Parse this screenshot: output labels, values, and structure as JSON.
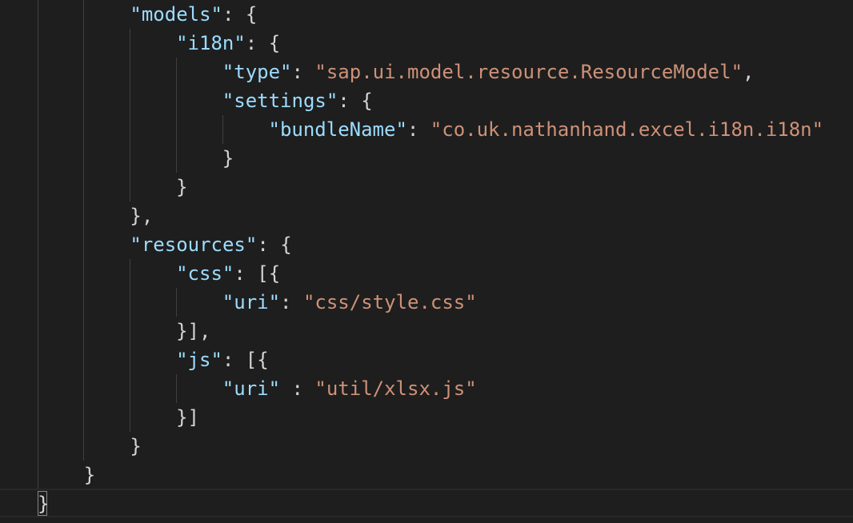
{
  "editor": {
    "theme_colors": {
      "background": "#1e1e1e",
      "property_key": "#9cdcfe",
      "string_value": "#ce9178",
      "punctuation": "#d4d4d4",
      "indent_guide": "#404040"
    },
    "lines": [
      {
        "indent": 2,
        "parts": [
          {
            "t": "key",
            "v": "\"models\""
          },
          {
            "t": "pun",
            "v": ": {"
          }
        ]
      },
      {
        "indent": 3,
        "parts": [
          {
            "t": "key",
            "v": "\"i18n\""
          },
          {
            "t": "pun",
            "v": ": {"
          }
        ]
      },
      {
        "indent": 4,
        "parts": [
          {
            "t": "key",
            "v": "\"type\""
          },
          {
            "t": "pun",
            "v": ": "
          },
          {
            "t": "str",
            "v": "\"sap.ui.model.resource.ResourceModel\""
          },
          {
            "t": "pun",
            "v": ","
          }
        ]
      },
      {
        "indent": 4,
        "parts": [
          {
            "t": "key",
            "v": "\"settings\""
          },
          {
            "t": "pun",
            "v": ": {"
          }
        ]
      },
      {
        "indent": 5,
        "parts": [
          {
            "t": "key",
            "v": "\"bundleName\""
          },
          {
            "t": "pun",
            "v": ": "
          },
          {
            "t": "str",
            "v": "\"co.uk.nathanhand.excel.i18n.i18n\""
          }
        ]
      },
      {
        "indent": 4,
        "parts": [
          {
            "t": "pun",
            "v": "}"
          }
        ]
      },
      {
        "indent": 3,
        "parts": [
          {
            "t": "pun",
            "v": "}"
          }
        ]
      },
      {
        "indent": 2,
        "parts": [
          {
            "t": "pun",
            "v": "},"
          }
        ]
      },
      {
        "indent": 2,
        "parts": [
          {
            "t": "key",
            "v": "\"resources\""
          },
          {
            "t": "pun",
            "v": ": {"
          }
        ]
      },
      {
        "indent": 3,
        "parts": [
          {
            "t": "key",
            "v": "\"css\""
          },
          {
            "t": "pun",
            "v": ": [{"
          }
        ]
      },
      {
        "indent": 4,
        "parts": [
          {
            "t": "key",
            "v": "\"uri\""
          },
          {
            "t": "pun",
            "v": ": "
          },
          {
            "t": "str",
            "v": "\"css/style.css\""
          }
        ]
      },
      {
        "indent": 3,
        "parts": [
          {
            "t": "pun",
            "v": "}],"
          }
        ]
      },
      {
        "indent": 3,
        "parts": [
          {
            "t": "key",
            "v": "\"js\""
          },
          {
            "t": "pun",
            "v": ": [{"
          }
        ]
      },
      {
        "indent": 4,
        "parts": [
          {
            "t": "key",
            "v": "\"uri\""
          },
          {
            "t": "pun",
            "v": " : "
          },
          {
            "t": "str",
            "v": "\"util/xlsx.js\""
          }
        ]
      },
      {
        "indent": 3,
        "parts": [
          {
            "t": "pun",
            "v": "}]"
          }
        ]
      },
      {
        "indent": 2,
        "parts": [
          {
            "t": "pun",
            "v": "}"
          }
        ]
      },
      {
        "indent": 1,
        "parts": [
          {
            "t": "pun",
            "v": "}"
          }
        ]
      },
      {
        "indent": 0,
        "parts": [
          {
            "t": "pun",
            "v": "}"
          }
        ]
      }
    ]
  }
}
